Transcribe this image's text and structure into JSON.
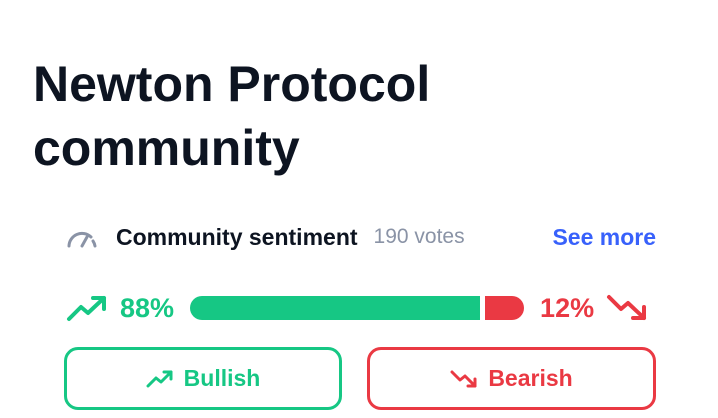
{
  "title": "Newton Protocol community",
  "sentiment": {
    "label": "Community sentiment",
    "votes": "190 votes",
    "see_more": "See more",
    "bullish_pct_text": "88%",
    "bearish_pct_text": "12%",
    "bullish_fraction": 0.88,
    "bearish_fraction": 0.12
  },
  "buttons": {
    "bullish": "Bullish",
    "bearish": "Bearish"
  },
  "colors": {
    "bullish": "#16c784",
    "bearish": "#ea3943",
    "link": "#3861fb",
    "text": "#0d1421",
    "muted": "#8a93a6"
  },
  "icons": {
    "gauge": "gauge-icon",
    "trend_up": "trend-up-icon",
    "trend_down": "trend-down-icon"
  }
}
